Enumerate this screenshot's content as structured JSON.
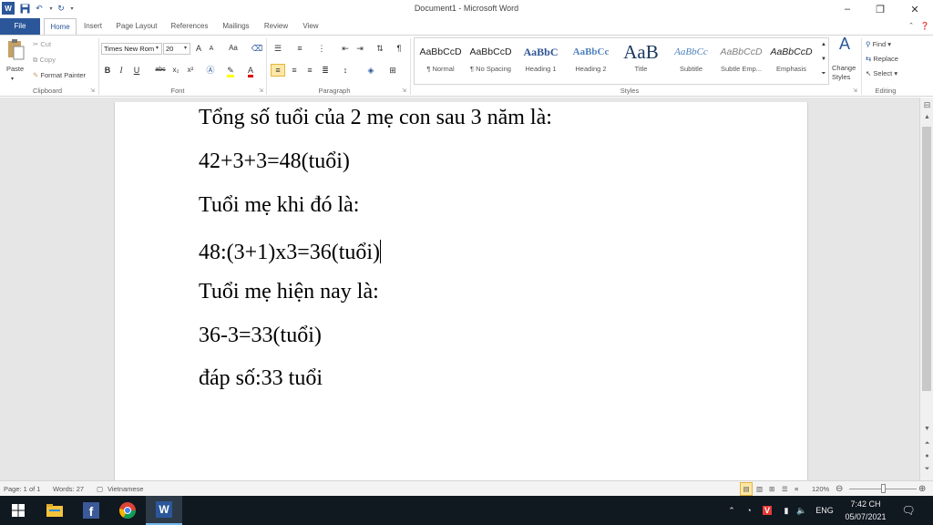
{
  "titlebar": {
    "title": "Document1 - Microsoft Word",
    "minimize": "–",
    "restore": "❐",
    "close": "✕"
  },
  "tabs": [
    "File",
    "Home",
    "Insert",
    "Page Layout",
    "References",
    "Mailings",
    "Review",
    "View"
  ],
  "ribbon": {
    "clipboard": {
      "label": "Clipboard",
      "paste": "Paste",
      "cut": "Cut",
      "copy": "Copy",
      "format_painter": "Format Painter"
    },
    "font": {
      "label": "Font",
      "family": "Times New Rom",
      "size": "20",
      "grow": "A",
      "shrink": "A",
      "change_case": "Aa",
      "bold": "B",
      "italic": "I",
      "underline": "U",
      "strike": "abc",
      "subscript": "x₂",
      "superscript": "x²",
      "font_color": "A"
    },
    "paragraph": {
      "label": "Paragraph",
      "pilcrow": "¶"
    },
    "styles": {
      "label": "Styles",
      "items": [
        {
          "preview": "AaBbCcD",
          "name": "¶ Normal"
        },
        {
          "preview": "AaBbCcD",
          "name": "¶ No Spacing"
        },
        {
          "preview": "AaBbC",
          "name": "Heading 1"
        },
        {
          "preview": "AaBbCc",
          "name": "Heading 2"
        },
        {
          "preview": "AaB",
          "name": "Title"
        },
        {
          "preview": "AaBbCc",
          "name": "Subtitle"
        },
        {
          "preview": "AaBbCcD",
          "name": "Subtle Emp..."
        },
        {
          "preview": "AaBbCcD",
          "name": "Emphasis"
        }
      ],
      "change_styles_1": "Change",
      "change_styles_2": "Styles"
    },
    "editing": {
      "label": "Editing",
      "find": "Find",
      "replace": "Replace",
      "select": "Select"
    }
  },
  "document": {
    "paragraphs": [
      "Tổng số tuổi của 2 mẹ con sau 3 năm là:",
      "42+3+3=48(tuổi)",
      "Tuổi mẹ khi đó là:",
      "48:(3+1)x3=36(tuổi)",
      "Tuổi mẹ hiện nay là:",
      "36-3=33(tuổi)",
      "đáp số:33  tuổi"
    ]
  },
  "statusbar": {
    "page": "Page: 1 of 1",
    "words": "Words: 27",
    "language": "Vietnamese",
    "zoom": "120%"
  },
  "taskbar": {
    "language": "ENG",
    "time": "7:42 CH",
    "date": "05/07/2021"
  },
  "colors": {
    "word_blue": "#2b579a",
    "taskbar_bg": "#101820",
    "canvas_bg": "#e6e6e6"
  }
}
